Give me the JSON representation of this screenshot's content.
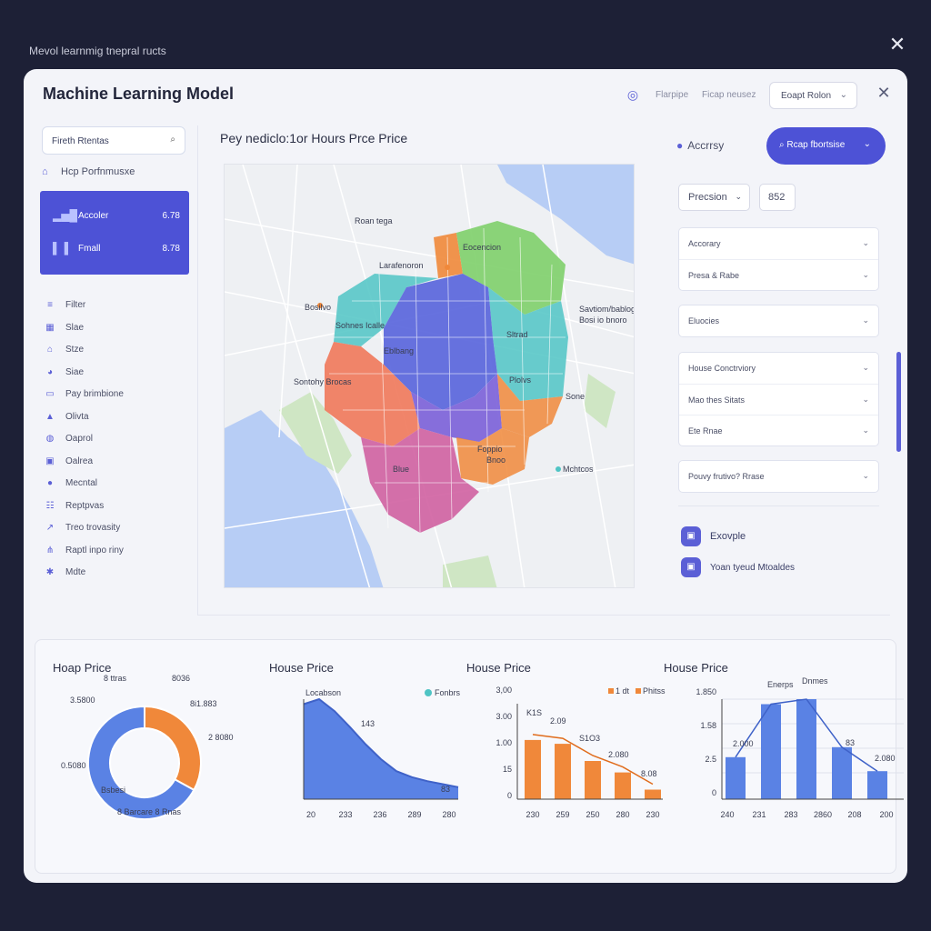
{
  "backdrop": {
    "title": "Mevol learnmig tnepral ructs"
  },
  "window": {
    "title": "Machine Learning Model"
  },
  "header": {
    "links": [
      "Flarpipe",
      "Ficap neusez"
    ],
    "select_label": "Eoapt Rolon"
  },
  "sidebar": {
    "search_placeholder": "Fireth Rtentas",
    "section_title": "Hcp Porfnmusxe",
    "perf_rows": [
      {
        "label": "Accoler",
        "value": "6.78"
      },
      {
        "label": "Fmall",
        "value": "8.78"
      }
    ],
    "nav": [
      {
        "label": "Filter",
        "icon": "sliders-icon"
      },
      {
        "label": "Slae",
        "icon": "grid-icon"
      },
      {
        "label": "Stze",
        "icon": "building-icon"
      },
      {
        "label": "Siae",
        "icon": "pie-icon"
      },
      {
        "label": "Pay brimbione",
        "icon": "card-icon"
      },
      {
        "label": "Olivta",
        "icon": "triangle-icon"
      },
      {
        "label": "Oaprol",
        "icon": "globe-icon"
      },
      {
        "label": "Oalrea",
        "icon": "lock-icon"
      },
      {
        "label": "Mecntal",
        "icon": "pin-icon"
      },
      {
        "label": "Reptpvas",
        "icon": "users-icon"
      },
      {
        "label": "Treo trovasity",
        "icon": "trend-icon"
      },
      {
        "label": "Raptl inpo riny",
        "icon": "network-icon"
      },
      {
        "label": "Mdte",
        "icon": "gear-icon"
      }
    ]
  },
  "map": {
    "title": "Pey nediclo:1or Hours Prce Price",
    "labels": [
      "Roan tega",
      "Eocencion",
      "Larafenoron",
      "Bosilvo",
      "Sohnes Icalle",
      "Savtiom/bablog",
      "Bosi io bnoro",
      "Eblbang",
      "Sltrad",
      "Sontohy Brocas",
      "Plolvs",
      "Sone",
      "Foppio",
      "Blue",
      "Bnoo",
      "Mchtcos"
    ]
  },
  "right_panel": {
    "accuracy_label": "Accrrsy",
    "perf_button": "Rcap fbortsise",
    "precision_label": "Precsion",
    "precision_value": "852",
    "group1": [
      "Accorary",
      "Presa & Rabe"
    ],
    "group2": [
      "Eluocies"
    ],
    "group3": [
      "House Conctrviory",
      "Mao thes Sitats",
      "Ete Rnae"
    ],
    "group4": [
      "Pouvy frutivo? Rrase"
    ],
    "examples": [
      "Exovple",
      "Yoan tyeud Mtoaldes"
    ]
  },
  "colors": {
    "accent": "#4d52d6",
    "blue": "#5a82e4",
    "orange": "#f0883a",
    "teal": "#4fc4c4",
    "green": "#7ecf6a",
    "purple": "#6c5fd8",
    "pink": "#cf5c9e"
  },
  "chart_data": [
    {
      "type": "pie",
      "title": "Hoap Price",
      "slices": [
        {
          "label": "Bsbtsne",
          "value": 33,
          "color": "#f0883a"
        },
        {
          "label": "Bsbsci",
          "value": 67,
          "color": "#5a82e4"
        }
      ],
      "annotations": [
        "8 ttras",
        "8036",
        "3.5800",
        "8i1.883",
        "2 8080",
        "0.5080",
        "Bsbesi",
        "8 Barcare 8 Rnas"
      ]
    },
    {
      "type": "area",
      "title": "House Price",
      "legend": [
        "Fonbrs"
      ],
      "series_label": "Locabson",
      "x": [
        "20",
        "233",
        "236",
        "289",
        "280"
      ],
      "values": [
        95,
        100,
        88,
        72,
        55,
        40,
        28,
        22,
        18,
        15,
        12
      ],
      "annotations": [
        "143",
        "83"
      ]
    },
    {
      "type": "bar",
      "title": "House Price",
      "legend": [
        "1 dt",
        "Phitss"
      ],
      "y_ticks": [
        "3,00",
        "3.00",
        "1.00",
        "15",
        "0"
      ],
      "x": [
        "230",
        "259",
        "250",
        "280",
        "230"
      ],
      "values": [
        62,
        58,
        40,
        28,
        10
      ],
      "annotations": [
        "K1S",
        "2.09",
        "S1O3",
        "2.080",
        "8.08"
      ]
    },
    {
      "type": "bar",
      "title": "House Price",
      "legend": [
        "Enerps",
        "Dnmes"
      ],
      "y_ticks": [
        "1.850",
        "1.58",
        "2.5",
        "0"
      ],
      "x": [
        "240",
        "231",
        "283",
        "2860",
        "208",
        "200"
      ],
      "values": [
        42,
        95,
        100,
        52,
        28
      ],
      "annotations": [
        "2.000",
        "83",
        "2.080"
      ]
    }
  ]
}
